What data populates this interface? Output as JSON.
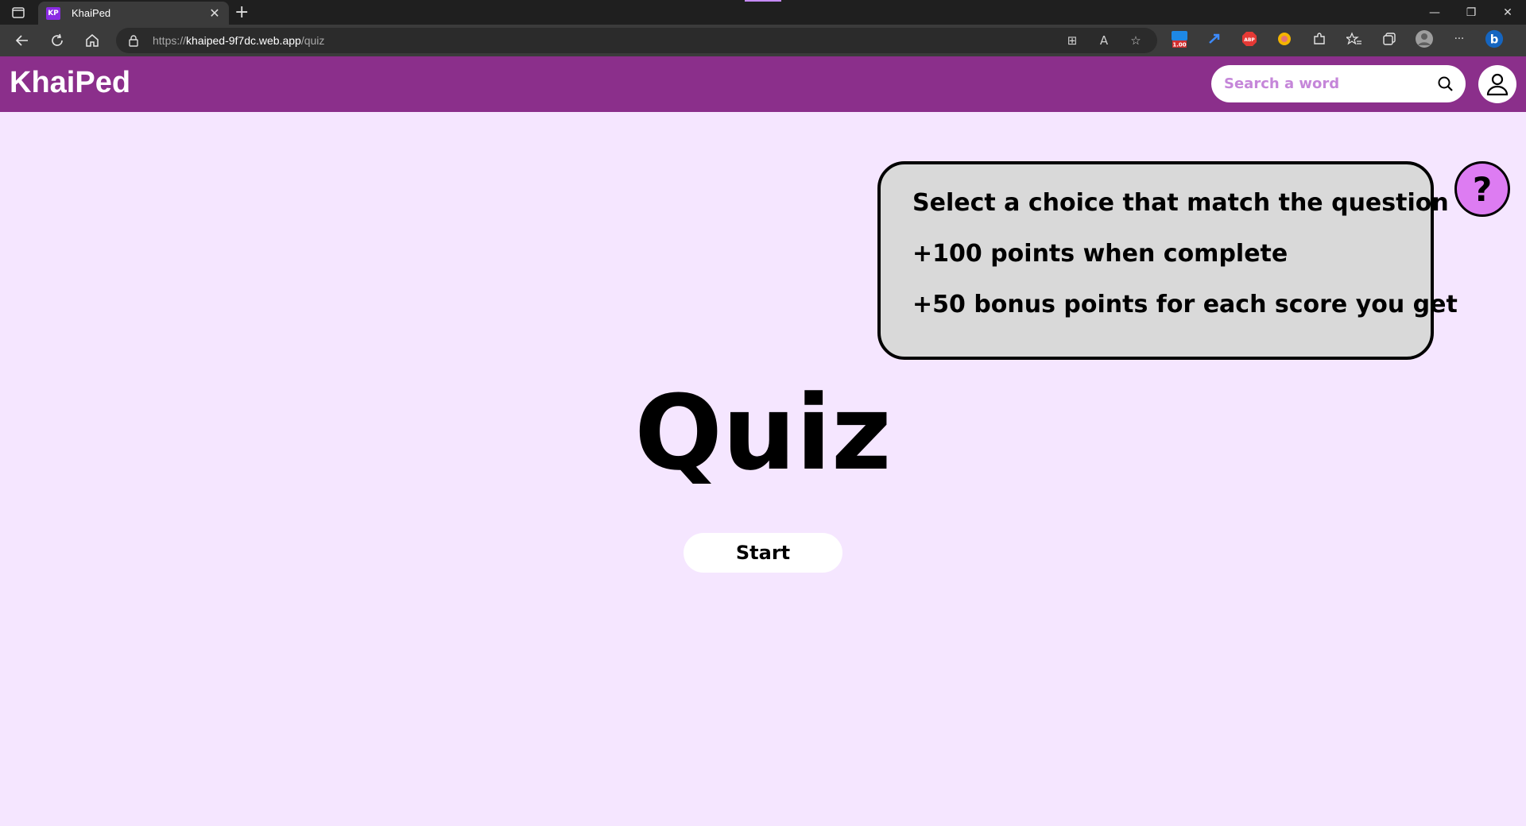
{
  "browser": {
    "tab_title": "KhaiPed",
    "tab_favicon_text": "KP",
    "url_scheme": "https://",
    "url_host": "khaiped-9f7dc.web.app",
    "url_path": "/quiz",
    "extension_badge": "1.00"
  },
  "header": {
    "logo": "KhaiPed",
    "search_placeholder": "Search a word"
  },
  "instructions": {
    "lines": [
      "Select a choice that match the question",
      "+100 points when complete",
      "+50 bonus points for each score you get"
    ]
  },
  "help_label": "?",
  "main": {
    "title": "Quiz",
    "start_label": "Start"
  },
  "colors": {
    "header_bg": "#8b2f8b",
    "page_bg": "#f5e6ff",
    "info_box_bg": "#d9d9d9",
    "help_bg": "#dd7cf2"
  }
}
